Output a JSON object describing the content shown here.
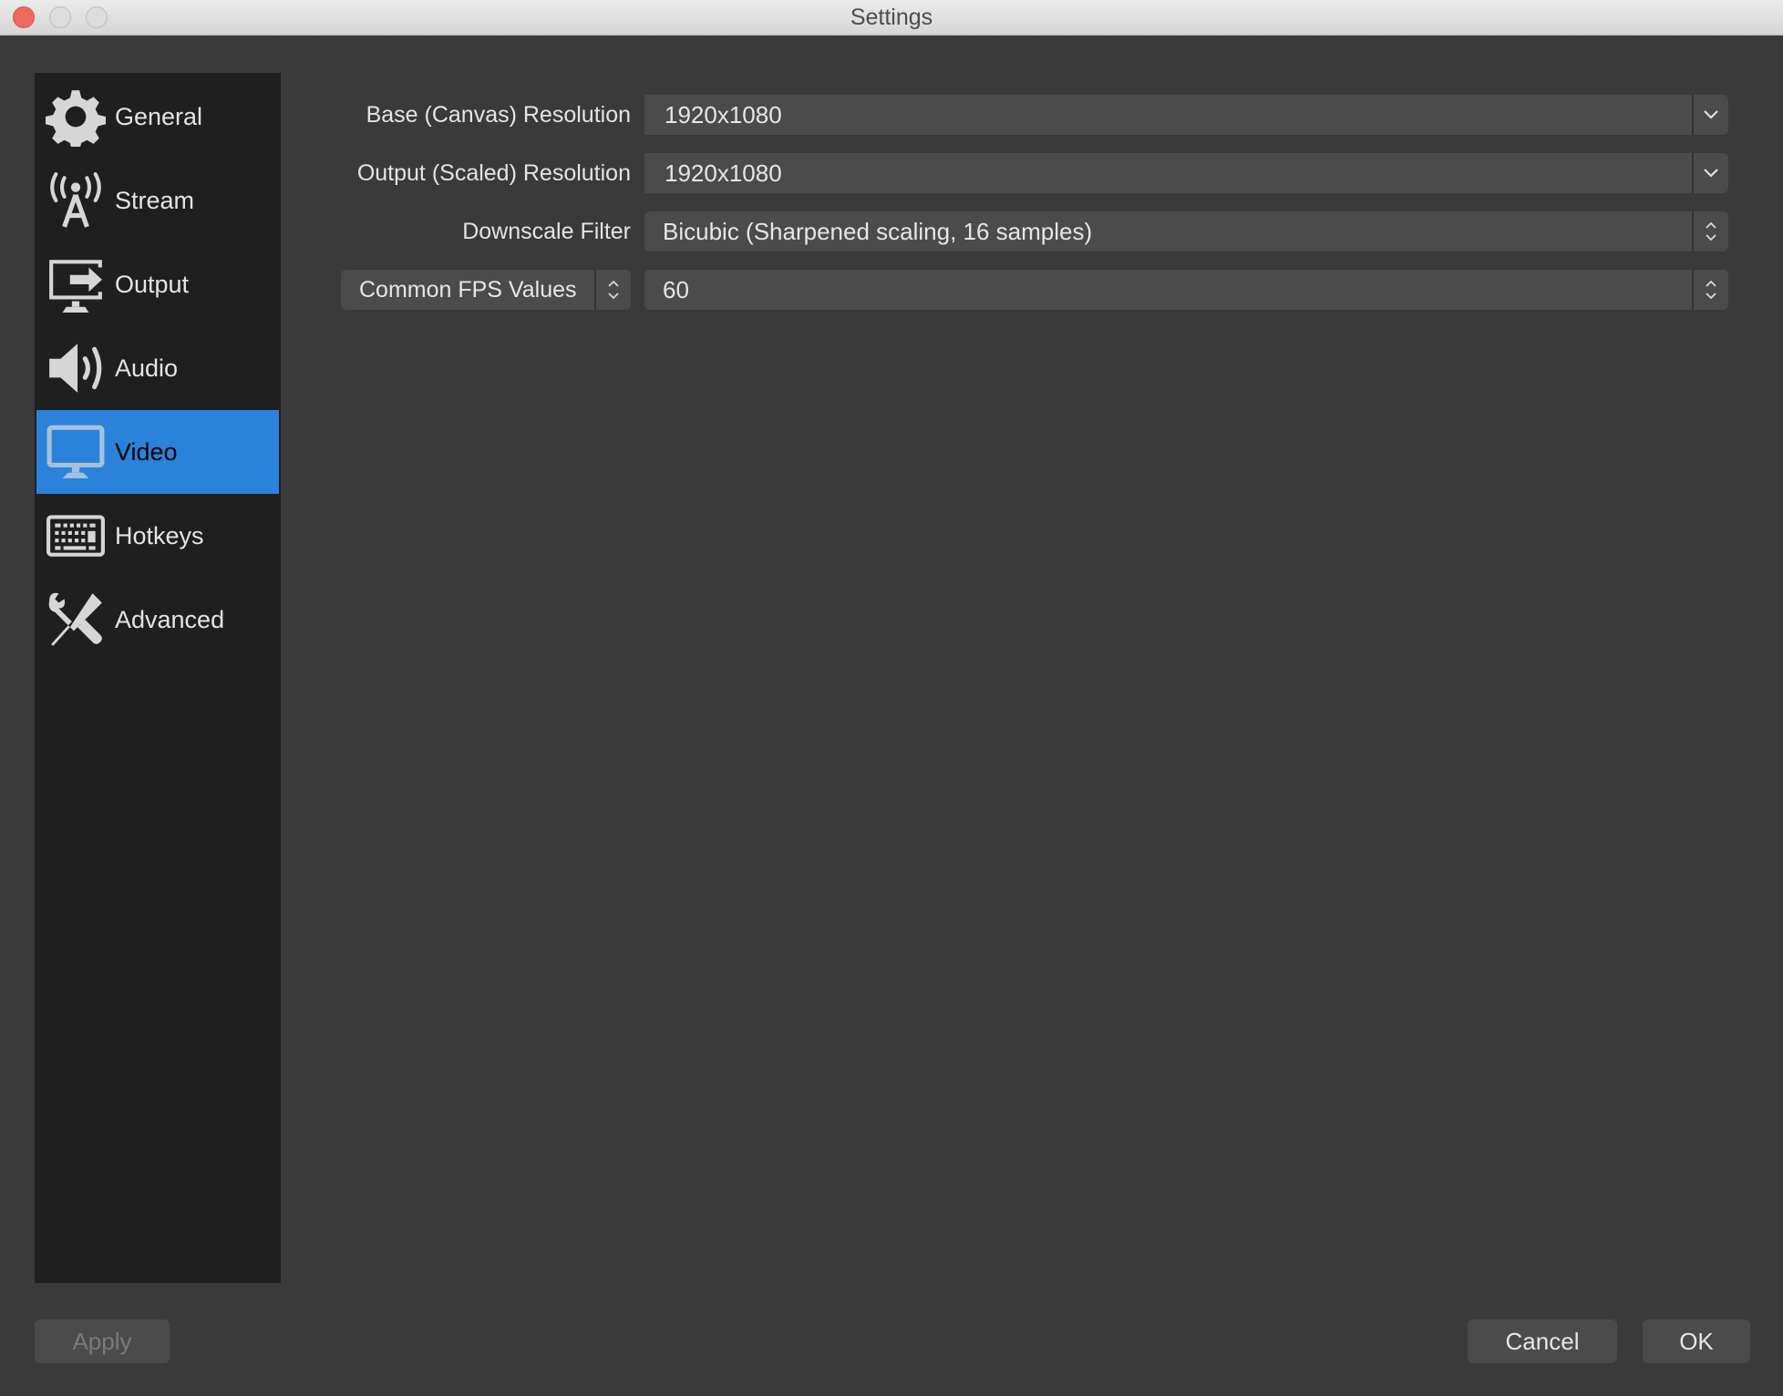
{
  "window": {
    "title": "Settings",
    "controls": [
      "close",
      "minimize",
      "maximize"
    ]
  },
  "sidebar": {
    "selected": "Video",
    "items": [
      {
        "label": "General",
        "icon": "gear-icon"
      },
      {
        "label": "Stream",
        "icon": "broadcast-tower-icon"
      },
      {
        "label": "Output",
        "icon": "monitor-output-icon"
      },
      {
        "label": "Audio",
        "icon": "speaker-icon"
      },
      {
        "label": "Video",
        "icon": "monitor-icon"
      },
      {
        "label": "Hotkeys",
        "icon": "keyboard-icon"
      },
      {
        "label": "Advanced",
        "icon": "tools-icon"
      }
    ]
  },
  "video": {
    "base_resolution": {
      "label": "Base (Canvas) Resolution",
      "value": "1920x1080"
    },
    "output_resolution": {
      "label": "Output (Scaled) Resolution",
      "value": "1920x1080"
    },
    "downscale_filter": {
      "label": "Downscale Filter",
      "value": "Bicubic (Sharpened scaling, 16 samples)"
    },
    "fps": {
      "type": "Common FPS Values",
      "value": "60"
    }
  },
  "footer": {
    "apply": "Apply",
    "cancel": "Cancel",
    "ok": "OK"
  },
  "colors": {
    "selection": "#2a82da",
    "sidebar_bg": "#1f1f1f",
    "window_bg": "#3a3a3a",
    "field_bg": "#4b4b4b"
  }
}
